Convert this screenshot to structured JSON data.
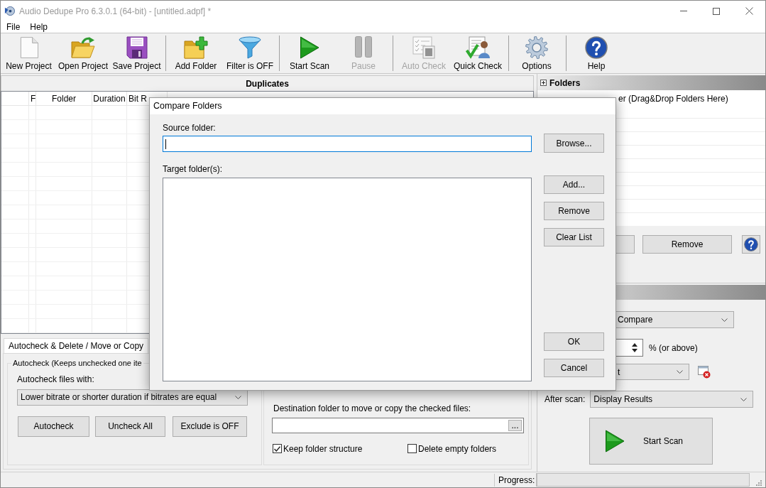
{
  "window": {
    "title": "Audio Dedupe Pro 6.3.0.1 (64-bit) - [untitled.adpf] *"
  },
  "menu": [
    "File",
    "Help"
  ],
  "toolbar": {
    "groups": [
      {
        "items": [
          {
            "label": "New Project",
            "disabled": false
          },
          {
            "label": "Open Project",
            "disabled": false
          },
          {
            "label": "Save Project",
            "disabled": false
          }
        ]
      },
      {
        "items": [
          {
            "label": "Add Folder",
            "disabled": false
          },
          {
            "label": "Filter is OFF",
            "disabled": false
          }
        ]
      },
      {
        "items": [
          {
            "label": "Start Scan",
            "disabled": false
          },
          {
            "label": "Pause",
            "disabled": true
          }
        ]
      },
      {
        "items": [
          {
            "label": "Auto Check",
            "disabled": true
          },
          {
            "label": "Quick Check",
            "disabled": false
          }
        ]
      },
      {
        "items": [
          {
            "label": "Options",
            "disabled": false
          }
        ]
      },
      {
        "items": [
          {
            "label": "Help",
            "disabled": false
          }
        ]
      }
    ]
  },
  "duplicates": {
    "title": "Duplicates",
    "columns": [
      "F",
      "Folder",
      "Duration",
      "Bit R"
    ]
  },
  "folders": {
    "title": "Folders",
    "list_header": "er (Drag&Drop Folders Here)",
    "buttons": [
      "Remove"
    ]
  },
  "scan_settings": {
    "compare_mode": "Compare",
    "threshold_unit": "% (or above)",
    "filter_value": "t",
    "after_scan": {
      "label": "After scan:",
      "value": "Display Results"
    },
    "start_button": "Start Scan"
  },
  "bottom_panel": {
    "tabs": [
      {
        "label": "Autocheck & Delete / Move or Copy",
        "selected": true
      }
    ],
    "autocheck": {
      "title": "Autocheck (Keeps unchecked one ite",
      "files_with_label": "Autocheck files with:",
      "files_with_value": "Lower bitrate or shorter duration if bitrates are equal",
      "buttons": [
        "Autocheck",
        "Uncheck All",
        "Exclude is OFF"
      ]
    },
    "move_copy": {
      "destination_label": "Destination folder to move or copy the checked files:",
      "browse_button": "...",
      "options": [
        {
          "label": "Keep folder structure",
          "checked": true
        },
        {
          "label": "Delete empty folders",
          "checked": false
        }
      ]
    }
  },
  "status_bar": {
    "progress_label": "Progress:",
    "level": 0
  },
  "dialog": {
    "title": "Compare Folders",
    "source_label": "Source folder:",
    "source_focused": true,
    "browse_button": "Browse...",
    "target_label": "Target folder(s):",
    "list_buttons": [
      "Add...",
      "Remove",
      "Clear List"
    ],
    "buttons": [
      "OK",
      "Cancel"
    ]
  }
}
